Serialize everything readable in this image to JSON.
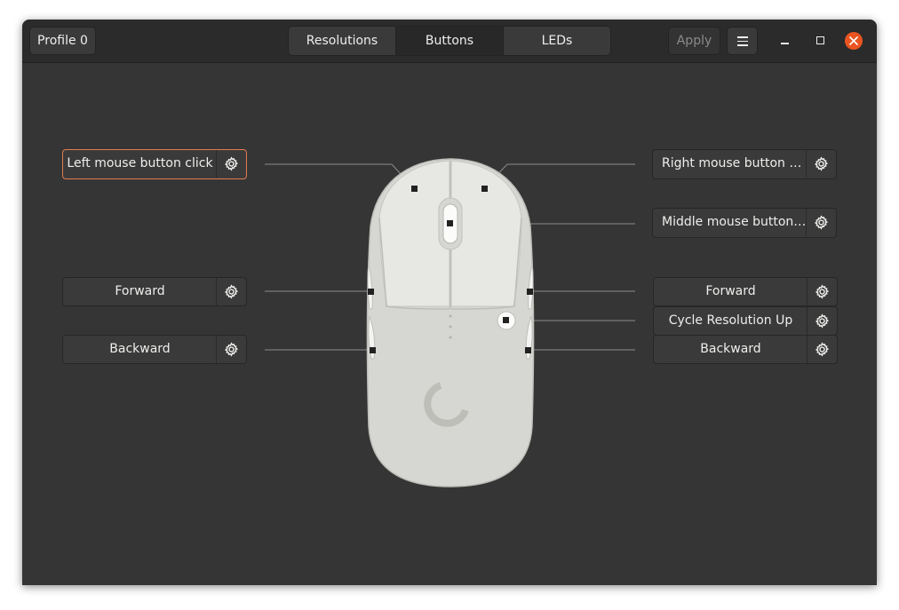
{
  "header": {
    "profile_label": "Profile 0",
    "tabs": [
      {
        "label": "Resolutions",
        "active": false
      },
      {
        "label": "Buttons",
        "active": true
      },
      {
        "label": "LEDs",
        "active": false
      }
    ],
    "apply_label": "Apply",
    "menu_icon": "hamburger-menu-icon",
    "window_controls": [
      "minimize-icon",
      "maximize-icon",
      "close-icon"
    ]
  },
  "buttons": {
    "left_click": "Left mouse button click",
    "right_click": "Right mouse button c…",
    "middle_click": "Middle mouse button…",
    "left_forward": "Forward",
    "left_backward": "Backward",
    "right_forward": "Forward",
    "cycle_resolution": "Cycle Resolution Up",
    "right_backward": "Backward"
  },
  "colors": {
    "accent": "#e95420",
    "selected_outline": "#e07c4f",
    "background": "#353535",
    "mouse_body": "#d6d6d2"
  }
}
